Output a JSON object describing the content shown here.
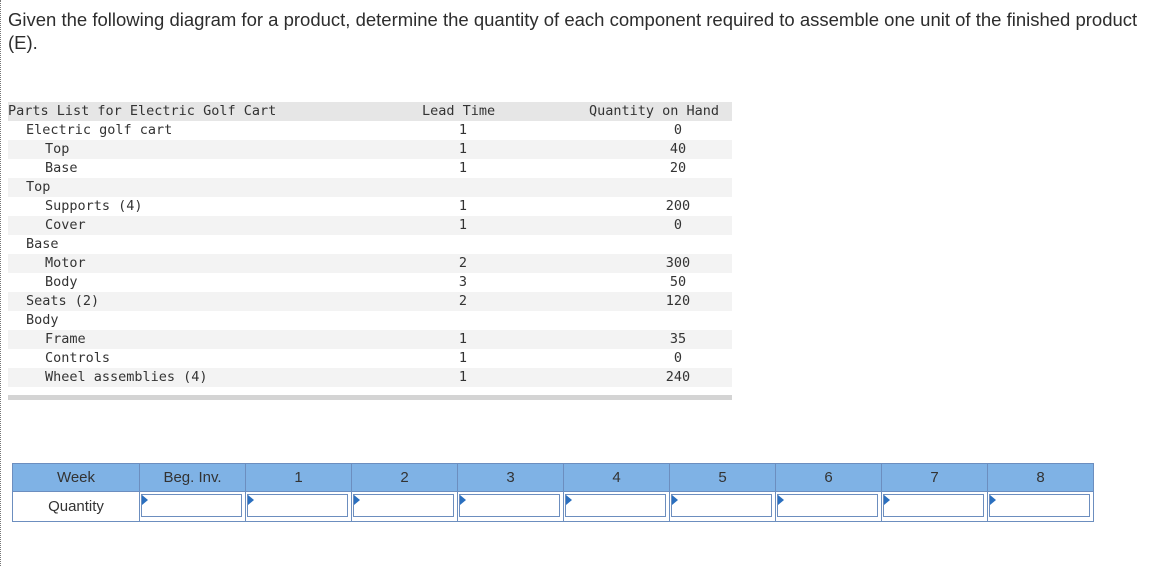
{
  "question": "Given the following diagram for a product, determine the quantity of each component required to assemble one unit of the finished product (E).",
  "parts_list": {
    "headers": {
      "name": "Parts List for Electric Golf Cart",
      "lead_time": "Lead Time",
      "qty_on_hand": "Quantity on Hand"
    },
    "rows": [
      {
        "name": "Electric golf cart",
        "lead": "1",
        "qty": "0"
      },
      {
        "name": "Top",
        "lead": "1",
        "qty": "40"
      },
      {
        "name": "Base",
        "lead": "1",
        "qty": "20"
      },
      {
        "name": "Top",
        "lead": "",
        "qty": ""
      },
      {
        "name": "Supports (4)",
        "lead": "1",
        "qty": "200"
      },
      {
        "name": "Cover",
        "lead": "1",
        "qty": "0"
      },
      {
        "name": "Base",
        "lead": "",
        "qty": ""
      },
      {
        "name": "Motor",
        "lead": "2",
        "qty": "300"
      },
      {
        "name": "Body",
        "lead": "3",
        "qty": "50"
      },
      {
        "name": "Seats (2)",
        "lead": "2",
        "qty": "120"
      },
      {
        "name": "Body",
        "lead": "",
        "qty": ""
      },
      {
        "name": "Frame",
        "lead": "1",
        "qty": "35"
      },
      {
        "name": "Controls",
        "lead": "1",
        "qty": "0"
      },
      {
        "name": "Wheel assemblies (4)",
        "lead": "1",
        "qty": "240"
      }
    ]
  },
  "answer_table": {
    "header_label": "Week",
    "beg_inv_label": "Beg. Inv.",
    "weeks": [
      "1",
      "2",
      "3",
      "4",
      "5",
      "6",
      "7",
      "8"
    ],
    "row_label": "Quantity",
    "values": [
      "",
      "",
      "",
      "",
      "",
      "",
      "",
      "",
      ""
    ]
  },
  "colors": {
    "header_blue": "#7fb2e5",
    "border_blue": "#6c8ebf",
    "flag_blue": "#2a6fbf"
  }
}
